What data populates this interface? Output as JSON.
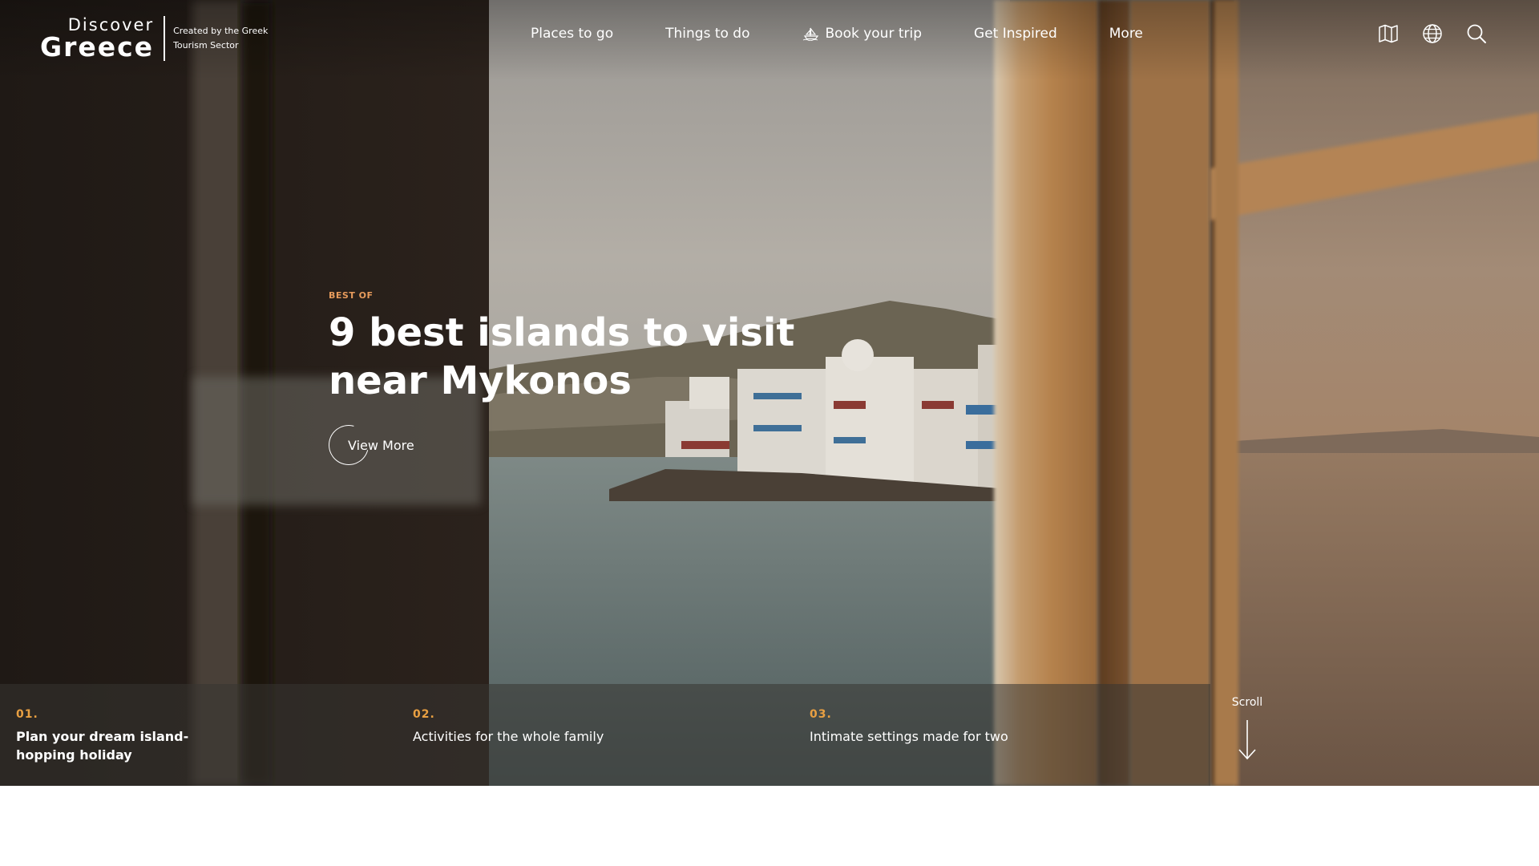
{
  "logo": {
    "top": "Discover",
    "main": "Greece",
    "tagline": "Created by the Greek Tourism Sector"
  },
  "nav": {
    "items": [
      {
        "label": "Places to go"
      },
      {
        "label": "Things to do"
      },
      {
        "label": "Book your trip",
        "icon": "boat-icon"
      },
      {
        "label": "Get Inspired"
      },
      {
        "label": "More"
      }
    ]
  },
  "tools": {
    "icons": [
      "map-icon",
      "globe-icon",
      "search-icon"
    ]
  },
  "hero": {
    "eyebrow": "BEST OF",
    "title": "9 best islands to visit near Mykonos",
    "cta_label": "View More"
  },
  "highlights": [
    {
      "number": "01.",
      "text": "Plan your dream island-hopping holiday"
    },
    {
      "number": "02.",
      "text": "Activities for the whole family"
    },
    {
      "number": "03.",
      "text": "Intimate settings made for two"
    }
  ],
  "scroll": {
    "label": "Scroll"
  },
  "colors": {
    "accent_orange": "#e79b5c",
    "number_gold": "#e9a042",
    "text_white": "#ffffff",
    "strip_overlay": "#373432"
  }
}
